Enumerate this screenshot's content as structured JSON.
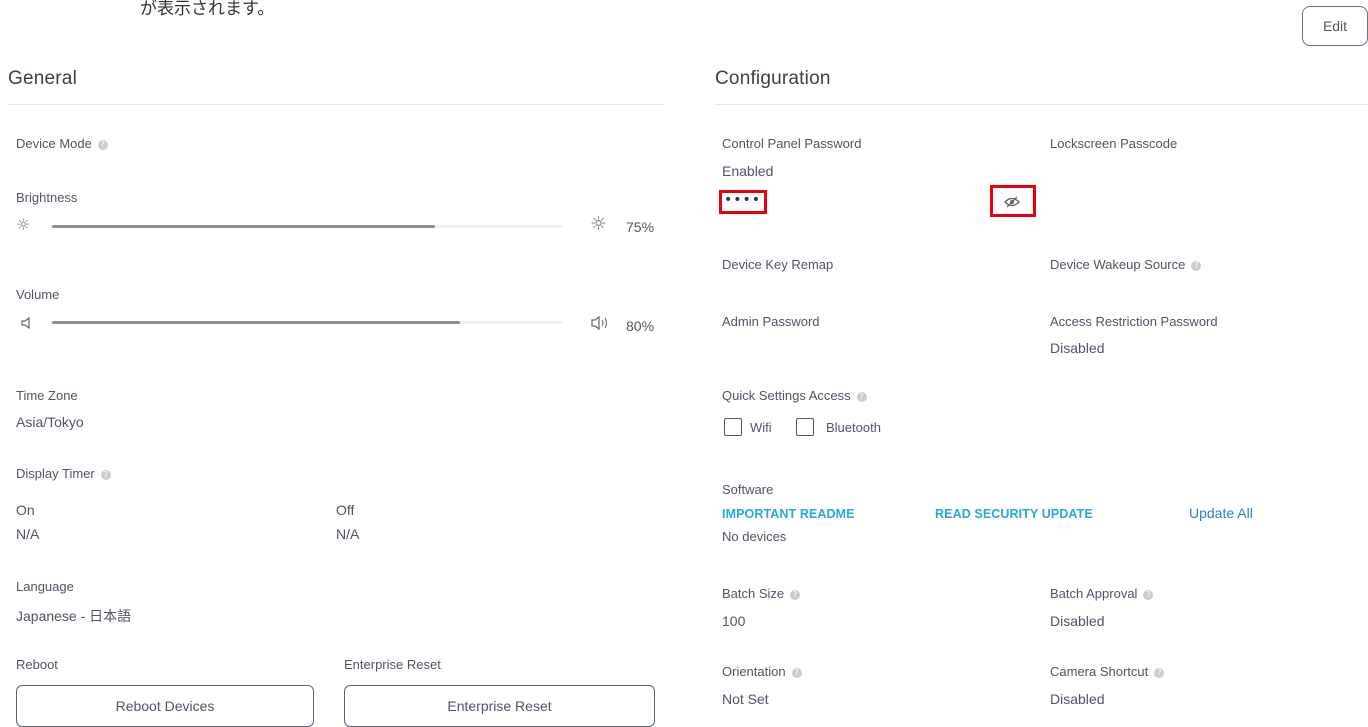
{
  "top_text": "が表示されます。",
  "edit_label": "Edit",
  "general": {
    "title": "General",
    "device_mode_label": "Device Mode",
    "brightness": {
      "label": "Brightness",
      "value": 75,
      "value_text": "75%"
    },
    "volume": {
      "label": "Volume",
      "value": 80,
      "value_text": "80%"
    },
    "time_zone": {
      "label": "Time Zone",
      "value": "Asia/Tokyo"
    },
    "display_timer": {
      "label": "Display Timer",
      "on_label": "On",
      "on_value": "N/A",
      "off_label": "Off",
      "off_value": "N/A"
    },
    "language": {
      "label": "Language",
      "value": "Japanese - 日本語"
    },
    "reboot": {
      "label": "Reboot",
      "button": "Reboot Devices"
    },
    "enterprise_reset": {
      "label": "Enterprise Reset",
      "button": "Enterprise Reset"
    }
  },
  "configuration": {
    "title": "Configuration",
    "control_panel_password": {
      "label": "Control Panel Password",
      "status": "Enabled",
      "masked": "••••"
    },
    "lockscreen_passcode": {
      "label": "Lockscreen Passcode"
    },
    "device_key_remap": {
      "label": "Device Key Remap"
    },
    "device_wakeup_source": {
      "label": "Device Wakeup Source"
    },
    "admin_password": {
      "label": "Admin Password"
    },
    "access_restriction_password": {
      "label": "Access Restriction Password",
      "value": "Disabled"
    },
    "quick_settings": {
      "label": "Quick Settings Access",
      "wifi_label": "Wifi",
      "wifi_checked": false,
      "bluetooth_label": "Bluetooth",
      "bluetooth_checked": false
    },
    "software": {
      "label": "Software",
      "important_readme": "IMPORTANT README",
      "read_security_update": "READ SECURITY UPDATE",
      "update_all": "Update All",
      "no_devices": "No devices"
    },
    "batch_size": {
      "label": "Batch Size",
      "value": "100"
    },
    "batch_approval": {
      "label": "Batch Approval",
      "value": "Disabled"
    },
    "orientation": {
      "label": "Orientation",
      "value": "Not Set"
    },
    "camera_shortcut": {
      "label": "Camera Shortcut",
      "value": "Disabled"
    }
  },
  "colors": {
    "highlight": "#e8000d",
    "link": "#29a7df",
    "update_all": "#2c7fcf",
    "slider_fill": "#8c8f97"
  },
  "icons": {
    "help": "question-circle-icon",
    "brightness_low": "sun-low-icon",
    "brightness_high": "sun-high-icon",
    "volume_low": "speaker-low-icon",
    "volume_high": "speaker-high-icon",
    "eye_hidden": "eye-off-icon"
  }
}
